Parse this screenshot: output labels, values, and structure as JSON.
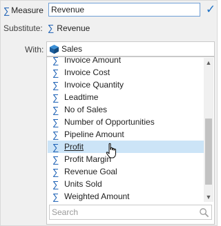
{
  "measure": {
    "tag_label": "Measure",
    "value": "Revenue"
  },
  "substitute": {
    "label": "Substitute:",
    "value": "Revenue"
  },
  "with": {
    "label": "With:",
    "value": "Sales"
  },
  "list": {
    "items": [
      {
        "label": "Invoice Amount"
      },
      {
        "label": "Invoice Cost"
      },
      {
        "label": "Invoice Quantity"
      },
      {
        "label": "Leadtime"
      },
      {
        "label": "No of Sales"
      },
      {
        "label": "Number of Opportunities"
      },
      {
        "label": "Pipeline Amount"
      },
      {
        "label": "Profit"
      },
      {
        "label": "Profit Margin"
      },
      {
        "label": "Revenue Goal"
      },
      {
        "label": "Units Sold"
      },
      {
        "label": "Weighted Amount"
      }
    ],
    "hovered_index": 7,
    "search_placeholder": "Search"
  },
  "icons": {
    "measure": "sigma-icon",
    "confirm": "checkmark-icon",
    "model": "cube-icon",
    "search": "search-icon",
    "cursor": "hand-pointer-icon"
  },
  "colors": {
    "accent": "#1a5fb4",
    "hover": "#cce4f7",
    "check": "#1c6fc4"
  }
}
